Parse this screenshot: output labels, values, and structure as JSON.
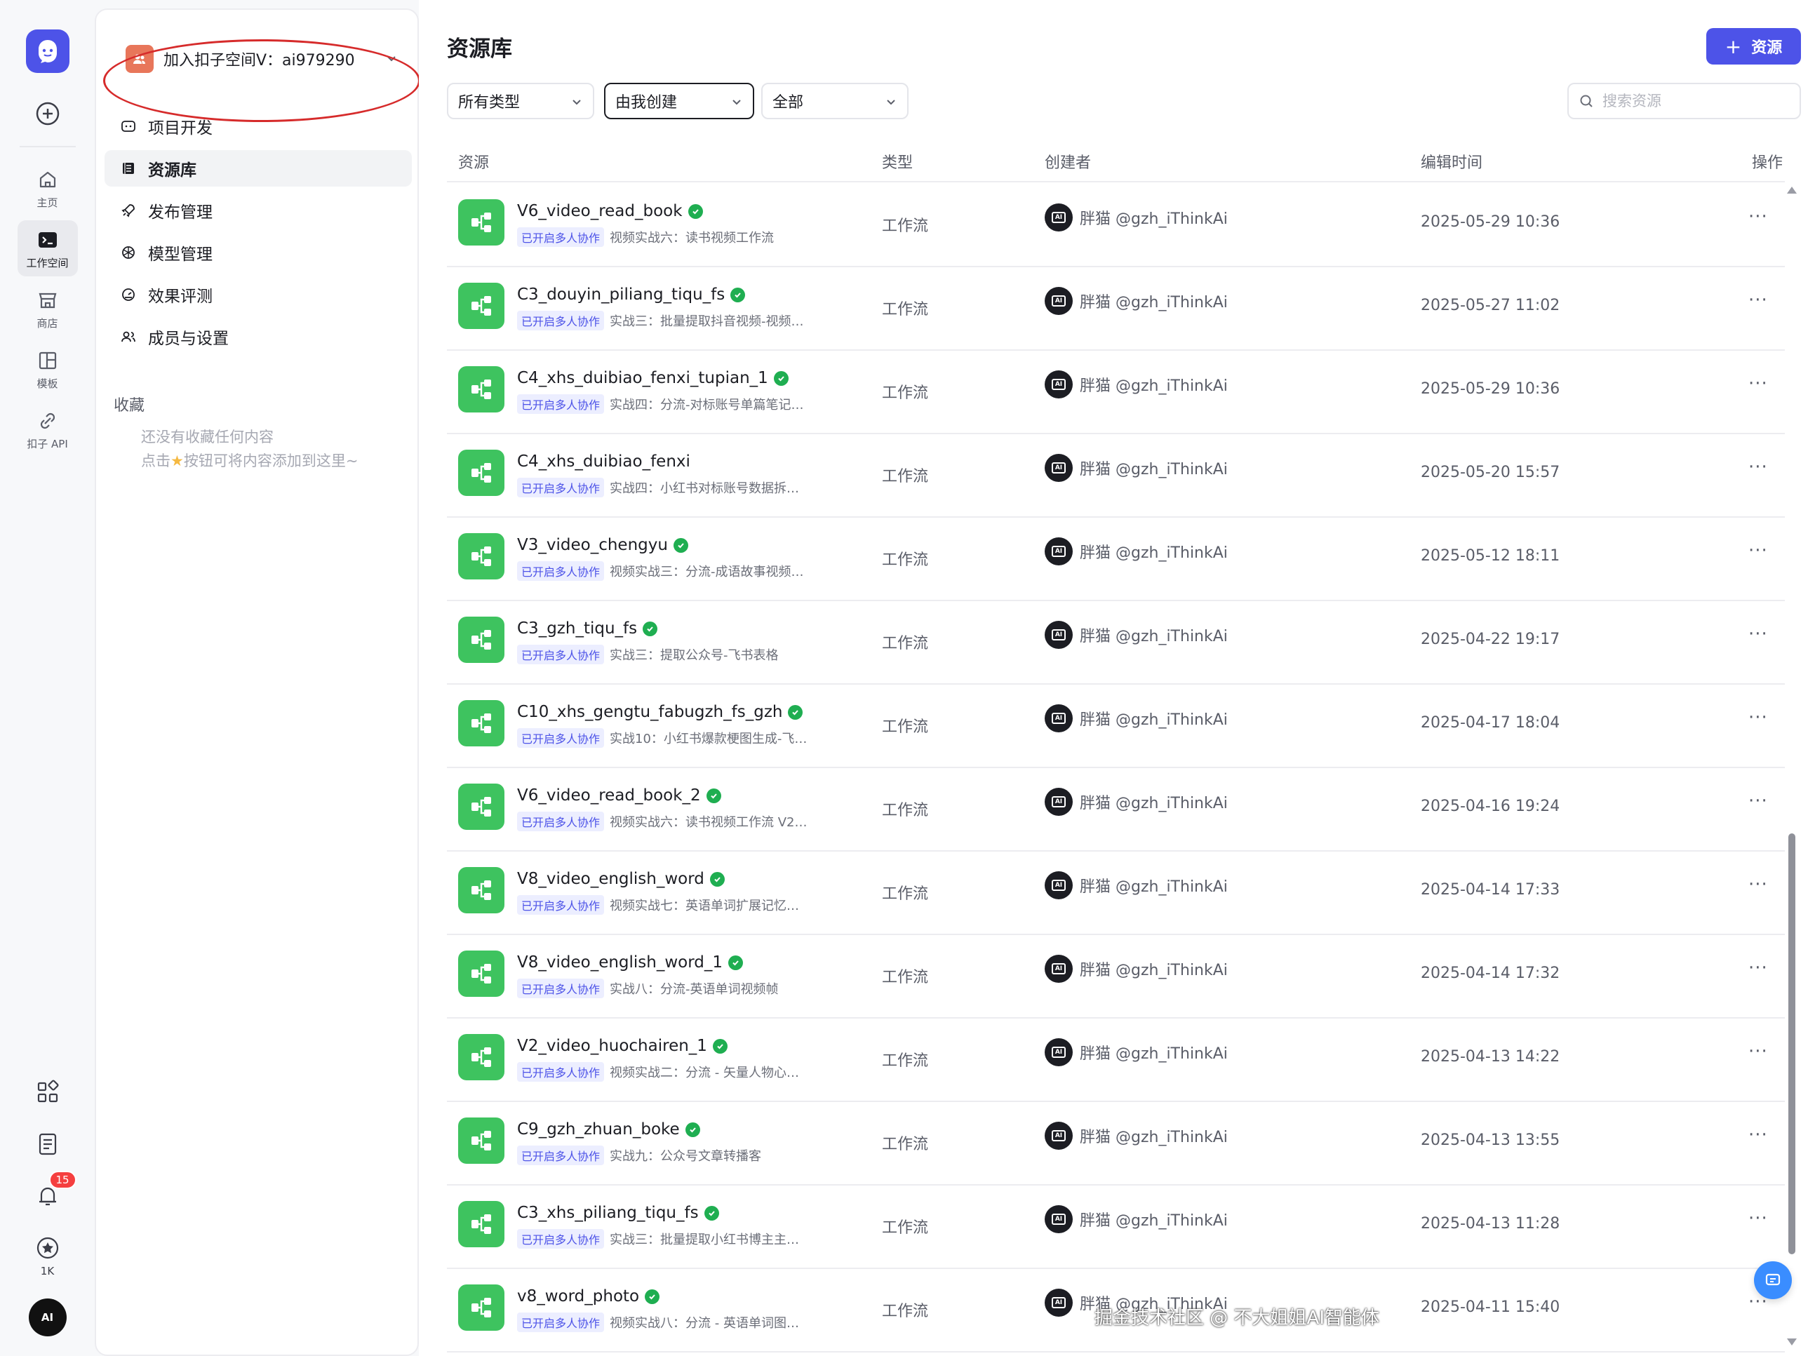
{
  "rail": {
    "items": [
      {
        "label": "主页",
        "icon": "home-icon"
      },
      {
        "label": "工作空间",
        "icon": "terminal-icon",
        "active": true
      },
      {
        "label": "商店",
        "icon": "store-icon"
      },
      {
        "label": "模板",
        "icon": "template-icon"
      },
      {
        "label": "扣子 API",
        "icon": "api-link-icon"
      }
    ],
    "notification_count": "15",
    "stars_count": "1K",
    "avatar_text": "AI"
  },
  "sidebar": {
    "workspace_name": "加入扣子空间V：ai979290",
    "nav": [
      {
        "label": "项目开发",
        "icon": "project-icon"
      },
      {
        "label": "资源库",
        "icon": "library-icon",
        "active": true
      },
      {
        "label": "发布管理",
        "icon": "rocket-icon"
      },
      {
        "label": "模型管理",
        "icon": "model-icon"
      },
      {
        "label": "效果评测",
        "icon": "gauge-icon"
      },
      {
        "label": "成员与设置",
        "icon": "members-icon"
      }
    ],
    "favorites_title": "收藏",
    "favorites_empty_line1": "还没有收藏任何内容",
    "favorites_empty_line2_pre": "点击",
    "favorites_empty_line2_post": "按钮可将内容添加到这里~"
  },
  "main": {
    "title": "资源库",
    "add_button_label": "资源",
    "filters": {
      "type": "所有类型",
      "creator": "由我创建",
      "scope": "全部"
    },
    "search_placeholder": "搜索资源",
    "columns": {
      "resource": "资源",
      "type": "类型",
      "creator": "创建者",
      "edit_time": "编辑时间",
      "actions": "操作"
    },
    "tag_label": "已开启多人协作",
    "creator_name": "胖猫 @gzh_iThinkAi",
    "rows": [
      {
        "name": "V6_video_read_book",
        "desc": "视频实战六：读书视频工作流",
        "type": "工作流",
        "time": "2025-05-29 10:36"
      },
      {
        "name": "C3_douyin_piliang_tiqu_fs",
        "desc": "实战三：批量提取抖音视频-视频…",
        "type": "工作流",
        "time": "2025-05-27 11:02"
      },
      {
        "name": "C4_xhs_duibiao_fenxi_tupian_1",
        "desc": "实战四：分流-对标账号单篇笔记…",
        "type": "工作流",
        "time": "2025-05-29 10:36"
      },
      {
        "name": "C4_xhs_duibiao_fenxi",
        "desc": "实战四：小红书对标账号数据拆…",
        "type": "工作流",
        "time": "2025-05-20 15:57",
        "no_check": true
      },
      {
        "name": "V3_video_chengyu",
        "desc": "视频实战三：分流-成语故事视频…",
        "type": "工作流",
        "time": "2025-05-12 18:11"
      },
      {
        "name": "C3_gzh_tiqu_fs",
        "desc": "实战三：提取公众号-飞书表格",
        "type": "工作流",
        "time": "2025-04-22 19:17"
      },
      {
        "name": "C10_xhs_gengtu_fabugzh_fs_gzh",
        "desc": "实战10：小红书爆款梗图生成-飞…",
        "type": "工作流",
        "time": "2025-04-17 18:04"
      },
      {
        "name": "V6_video_read_book_2",
        "desc": "视频实战六：读书视频工作流 V2…",
        "type": "工作流",
        "time": "2025-04-16 19:24"
      },
      {
        "name": "V8_video_english_word",
        "desc": "视频实战七：英语单词扩展记忆…",
        "type": "工作流",
        "time": "2025-04-14 17:33"
      },
      {
        "name": "V8_video_english_word_1",
        "desc": "实战八：分流-英语单词视频帧",
        "type": "工作流",
        "time": "2025-04-14 17:32"
      },
      {
        "name": "V2_video_huochairen_1",
        "desc": "视频实战二：分流 - 矢量人物心…",
        "type": "工作流",
        "time": "2025-04-13 14:22"
      },
      {
        "name": "C9_gzh_zhuan_boke",
        "desc": "实战九：公众号文章转播客",
        "type": "工作流",
        "time": "2025-04-13 13:55"
      },
      {
        "name": "C3_xhs_piliang_tiqu_fs",
        "desc": "实战三：批量提取小红书博主主…",
        "type": "工作流",
        "time": "2025-04-13 11:28"
      },
      {
        "name": "v8_word_photo",
        "desc": "视频实战八：分流 - 英语单词图…",
        "type": "工作流",
        "time": "2025-04-11 15:40"
      }
    ]
  },
  "watermark": "掘金技术社区 @ 不大姐姐AI智能体",
  "colors": {
    "accent": "#4d53e8",
    "workflow_icon": "#3ec35f",
    "verified": "#1fae51",
    "annotation": "#d62b2b",
    "badge": "#f53f3f"
  }
}
